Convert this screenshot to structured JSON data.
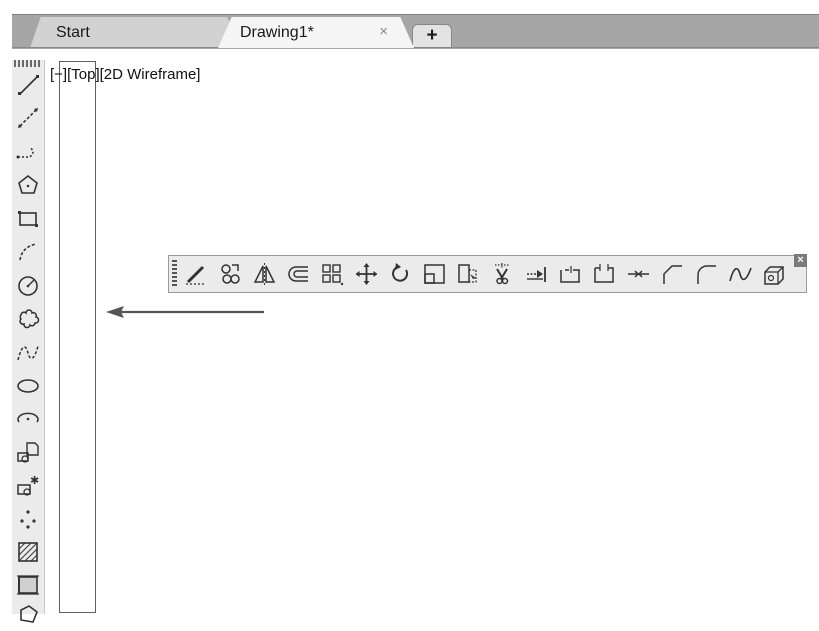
{
  "tabs": {
    "start_label": "Start",
    "active_label": "Drawing1*",
    "close_glyph": "×",
    "new_glyph": "+"
  },
  "viewport": {
    "label": "[−][Top][2D Wireframe]"
  },
  "draw_toolbar": {
    "tools": [
      "line-icon",
      "construction-line-icon",
      "polyline-icon",
      "polygon-icon",
      "rectangle-icon",
      "arc-icon",
      "circle-icon",
      "revision-cloud-icon",
      "spline-icon",
      "ellipse-icon",
      "ellipse-arc-icon",
      "insert-block-icon",
      "make-block-icon",
      "point-icon",
      "hatch-icon",
      "gradient-icon",
      "region-icon"
    ]
  },
  "modify_toolbar": {
    "close_glyph": "×",
    "tools": [
      "erase-icon",
      "copy-icon",
      "mirror-icon",
      "offset-icon",
      "array-icon",
      "move-icon",
      "rotate-icon",
      "scale-icon",
      "stretch-icon",
      "trim-icon",
      "extend-icon",
      "break-at-point-icon",
      "break-icon",
      "join-icon",
      "chamfer-icon",
      "fillet-icon",
      "blend-curves-icon",
      "explode-icon"
    ]
  }
}
